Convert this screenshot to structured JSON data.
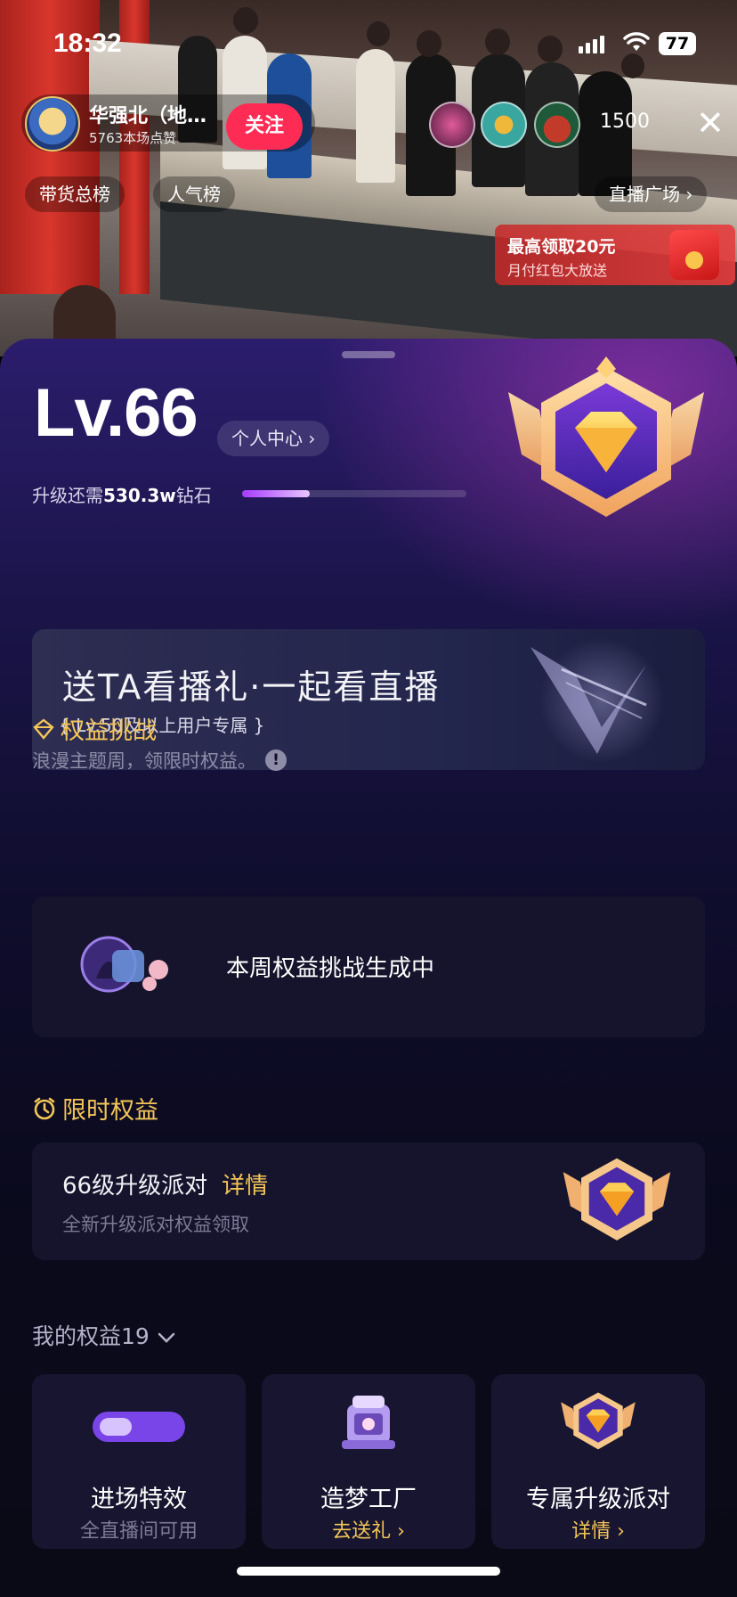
{
  "status_bar": {
    "time": "18:32",
    "battery": "77"
  },
  "live": {
    "host_name": "华强北（地…",
    "host_likes": "5763本场点赞",
    "follow_label": "关注",
    "viewer_count": "1500",
    "close_symbol": "✕",
    "tabs": [
      {
        "label": "带货总榜"
      },
      {
        "label": "人气榜"
      },
      {
        "label": "直播广场 ›"
      }
    ],
    "red_packet": {
      "title": "最高领取20元",
      "subtitle": "月付红包大放送"
    }
  },
  "level_panel": {
    "level": "Lv.66",
    "personal_center": "个人中心 ›",
    "upgrade_prefix": "升级还需",
    "upgrade_value": "530.3w",
    "upgrade_suffix": "钻石",
    "progress_fraction": 0.3
  },
  "banner": {
    "title": "送TA看播礼·一起看直播",
    "subtitle": "{ Lv.50及以上用户专属 }"
  },
  "challenge": {
    "title": "权益挑战",
    "subtitle": "浪漫主题周，领限时权益。",
    "info_symbol": "!",
    "card_text": "本周权益挑战生成中"
  },
  "limited": {
    "title": "限时权益",
    "item_title": "66级升级派对",
    "detail_link": "详情",
    "item_sub": "全新升级派对权益领取"
  },
  "my_benefits": {
    "title": "我的权益19",
    "items": [
      {
        "name": "进场特效",
        "sub": "全直播间可用"
      },
      {
        "name": "造梦工厂",
        "sub": "去送礼 ›"
      },
      {
        "name": "专属升级派对",
        "sub": "详情 ›"
      }
    ]
  },
  "colors": {
    "accent_gold": "#f4c558",
    "follow_red": "#fe2c55",
    "panel_bg": "#0f0d2c"
  }
}
